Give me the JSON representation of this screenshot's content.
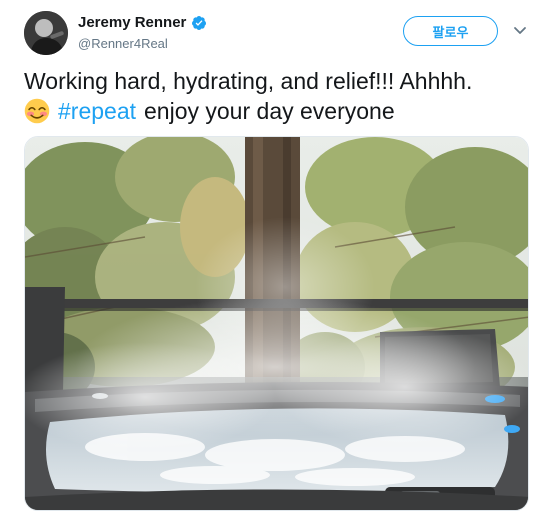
{
  "user": {
    "display_name": "Jeremy Renner",
    "handle": "@Renner4Real",
    "verified": true,
    "avatar_icon": "profile-photo"
  },
  "actions": {
    "follow_label": "팔로우",
    "more_icon": "chevron-down-icon"
  },
  "tweet": {
    "line1": "Working hard, hydrating, and relief!!!  Ahhhh.",
    "emoji_icon": "smiling-face-with-smiling-eyes-emoji",
    "hashtag": "#repeat",
    "line2_rest": "enjoy your day everyone"
  },
  "colors": {
    "accent": "#1da1f2",
    "text": "#14171a",
    "secondary": "#657786"
  }
}
